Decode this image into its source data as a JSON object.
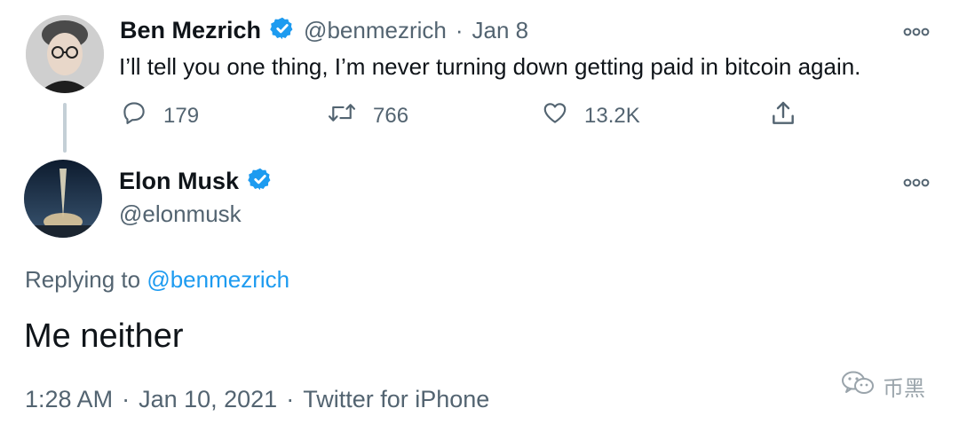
{
  "colors": {
    "accent": "#1d9bf0",
    "muted": "#536471",
    "text": "#0f1419",
    "thread_line": "#c4cfd6"
  },
  "parent_tweet": {
    "author_name": "Ben Mezrich",
    "handle": "@benmezrich",
    "separator": "·",
    "date": "Jan 8",
    "text": "I’ll tell you one thing, I’m never turning down getting paid in bitcoin again.",
    "reply_count": "179",
    "retweet_count": "766",
    "like_count": "13.2K",
    "icons": [
      "reply-icon",
      "retweet-icon",
      "like-icon",
      "share-icon",
      "more-icon",
      "verified-icon"
    ]
  },
  "main_tweet": {
    "author_name": "Elon Musk",
    "handle": "@elonmusk",
    "replying_prefix": "Replying to",
    "replying_handle": "@benmezrich",
    "text": "Me neither",
    "time": "1:28 AM",
    "date": "Jan 10, 2021",
    "source": "Twitter for iPhone",
    "separator": "·",
    "icons": [
      "more-icon",
      "verified-icon"
    ]
  },
  "watermark": {
    "text": "币黑",
    "icon": "wechat-icon"
  }
}
